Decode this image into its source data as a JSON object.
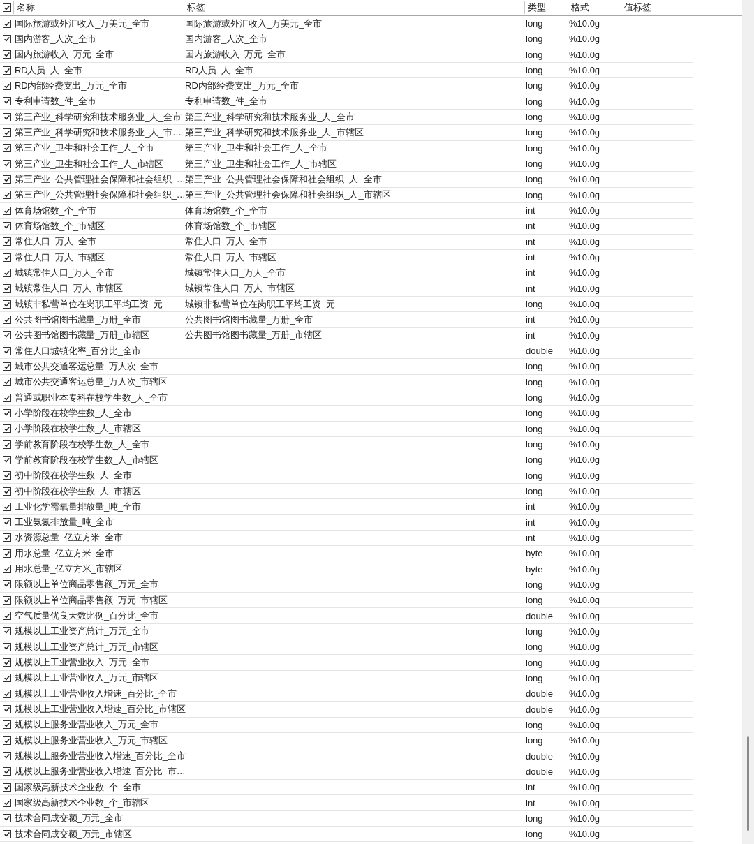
{
  "header": {
    "checked": true,
    "columns": [
      "名称",
      "标签",
      "类型",
      "格式",
      "值标签"
    ]
  },
  "rows": [
    {
      "checked": true,
      "name": "国际旅游或外汇收入_万美元_全市",
      "label": "国际旅游或外汇收入_万美元_全市",
      "type": "long",
      "format": "%10.0g"
    },
    {
      "checked": true,
      "name": "国内游客_人次_全市",
      "label": "国内游客_人次_全市",
      "type": "long",
      "format": "%10.0g"
    },
    {
      "checked": true,
      "name": "国内旅游收入_万元_全市",
      "label": "国内旅游收入_万元_全市",
      "type": "long",
      "format": "%10.0g"
    },
    {
      "checked": true,
      "name": "RD人员_人_全市",
      "label": "RD人员_人_全市",
      "type": "long",
      "format": "%10.0g"
    },
    {
      "checked": true,
      "name": "RD内部经费支出_万元_全市",
      "label": "RD内部经费支出_万元_全市",
      "type": "long",
      "format": "%10.0g"
    },
    {
      "checked": true,
      "name": "专利申请数_件_全市",
      "label": "专利申请数_件_全市",
      "type": "long",
      "format": "%10.0g"
    },
    {
      "checked": true,
      "name": "第三产业_科学研究和技术服务业_人_全市",
      "label": "第三产业_科学研究和技术服务业_人_全市",
      "type": "long",
      "format": "%10.0g"
    },
    {
      "checked": true,
      "name": "第三产业_科学研究和技术服务业_人_市…",
      "label": "第三产业_科学研究和技术服务业_人_市辖区",
      "type": "long",
      "format": "%10.0g"
    },
    {
      "checked": true,
      "name": "第三产业_卫生和社会工作_人_全市",
      "label": "第三产业_卫生和社会工作_人_全市",
      "type": "long",
      "format": "%10.0g"
    },
    {
      "checked": true,
      "name": "第三产业_卫生和社会工作_人_市辖区",
      "label": "第三产业_卫生和社会工作_人_市辖区",
      "type": "long",
      "format": "%10.0g"
    },
    {
      "checked": true,
      "name": "第三产业_公共管理社会保障和社会组织_…",
      "label": "第三产业_公共管理社会保障和社会组织_人_全市",
      "type": "long",
      "format": "%10.0g"
    },
    {
      "checked": true,
      "name": "第三产业_公共管理社会保障和社会组织_…",
      "label": "第三产业_公共管理社会保障和社会组织_人_市辖区",
      "type": "long",
      "format": "%10.0g"
    },
    {
      "checked": true,
      "name": "体育场馆数_个_全市",
      "label": "体育场馆数_个_全市",
      "type": "int",
      "format": "%10.0g"
    },
    {
      "checked": true,
      "name": "体育场馆数_个_市辖区",
      "label": "体育场馆数_个_市辖区",
      "type": "int",
      "format": "%10.0g"
    },
    {
      "checked": true,
      "name": "常住人口_万人_全市",
      "label": "常住人口_万人_全市",
      "type": "int",
      "format": "%10.0g"
    },
    {
      "checked": true,
      "name": "常住人口_万人_市辖区",
      "label": "常住人口_万人_市辖区",
      "type": "int",
      "format": "%10.0g"
    },
    {
      "checked": true,
      "name": "城镇常住人口_万人_全市",
      "label": "城镇常住人口_万人_全市",
      "type": "int",
      "format": "%10.0g"
    },
    {
      "checked": true,
      "name": "城镇常住人口_万人_市辖区",
      "label": "城镇常住人口_万人_市辖区",
      "type": "int",
      "format": "%10.0g"
    },
    {
      "checked": true,
      "name": "城镇非私营单位在岗职工平均工资_元",
      "label": "城镇非私营单位在岗职工平均工资_元",
      "type": "long",
      "format": "%10.0g"
    },
    {
      "checked": true,
      "name": "公共图书馆图书藏量_万册_全市",
      "label": "公共图书馆图书藏量_万册_全市",
      "type": "int",
      "format": "%10.0g"
    },
    {
      "checked": true,
      "name": "公共图书馆图书藏量_万册_市辖区",
      "label": "公共图书馆图书藏量_万册_市辖区",
      "type": "int",
      "format": "%10.0g"
    },
    {
      "checked": true,
      "name": "常住人口城镇化率_百分比_全市",
      "type": "double",
      "format": "%10.0g"
    },
    {
      "checked": true,
      "name": "城市公共交通客运总量_万人次_全市",
      "type": "long",
      "format": "%10.0g"
    },
    {
      "checked": true,
      "name": "城市公共交通客运总量_万人次_市辖区",
      "type": "long",
      "format": "%10.0g"
    },
    {
      "checked": true,
      "name": "普通或职业本专科在校学生数_人_全市",
      "type": "long",
      "format": "%10.0g"
    },
    {
      "checked": true,
      "name": "小学阶段在校学生数_人_全市",
      "type": "long",
      "format": "%10.0g"
    },
    {
      "checked": true,
      "name": "小学阶段在校学生数_人_市辖区",
      "type": "long",
      "format": "%10.0g"
    },
    {
      "checked": true,
      "name": "学前教育阶段在校学生数_人_全市",
      "type": "long",
      "format": "%10.0g"
    },
    {
      "checked": true,
      "name": "学前教育阶段在校学生数_人_市辖区",
      "type": "long",
      "format": "%10.0g"
    },
    {
      "checked": true,
      "name": "初中阶段在校学生数_人_全市",
      "type": "long",
      "format": "%10.0g"
    },
    {
      "checked": true,
      "name": "初中阶段在校学生数_人_市辖区",
      "type": "long",
      "format": "%10.0g"
    },
    {
      "checked": true,
      "name": "工业化学需氧量排放量_吨_全市",
      "type": "int",
      "format": "%10.0g"
    },
    {
      "checked": true,
      "name": "工业氨氮排放量_吨_全市",
      "type": "int",
      "format": "%10.0g"
    },
    {
      "checked": true,
      "name": "水资源总量_亿立方米_全市",
      "type": "int",
      "format": "%10.0g"
    },
    {
      "checked": true,
      "name": "用水总量_亿立方米_全市",
      "type": "byte",
      "format": "%10.0g"
    },
    {
      "checked": true,
      "name": "用水总量_亿立方米_市辖区",
      "type": "byte",
      "format": "%10.0g"
    },
    {
      "checked": true,
      "name": "限额以上单位商品零售额_万元_全市",
      "type": "long",
      "format": "%10.0g"
    },
    {
      "checked": true,
      "name": "限额以上单位商品零售额_万元_市辖区",
      "type": "long",
      "format": "%10.0g"
    },
    {
      "checked": true,
      "name": "空气质量优良天数比例_百分比_全市",
      "type": "double",
      "format": "%10.0g"
    },
    {
      "checked": true,
      "name": "规模以上工业资产总计_万元_全市",
      "type": "long",
      "format": "%10.0g"
    },
    {
      "checked": true,
      "name": "规模以上工业资产总计_万元_市辖区",
      "type": "long",
      "format": "%10.0g"
    },
    {
      "checked": true,
      "name": "规模以上工业营业收入_万元_全市",
      "type": "long",
      "format": "%10.0g"
    },
    {
      "checked": true,
      "name": "规模以上工业营业收入_万元_市辖区",
      "type": "long",
      "format": "%10.0g"
    },
    {
      "checked": true,
      "name": "规模以上工业营业收入增速_百分比_全市",
      "type": "double",
      "format": "%10.0g"
    },
    {
      "checked": true,
      "name": "规模以上工业营业收入增速_百分比_市辖区",
      "type": "double",
      "format": "%10.0g"
    },
    {
      "checked": true,
      "name": "规模以上服务业营业收入_万元_全市",
      "type": "long",
      "format": "%10.0g"
    },
    {
      "checked": true,
      "name": "规模以上服务业营业收入_万元_市辖区",
      "type": "long",
      "format": "%10.0g"
    },
    {
      "checked": true,
      "name": "规模以上服务业营业收入增速_百分比_全市",
      "type": "double",
      "format": "%10.0g"
    },
    {
      "checked": true,
      "name": "规模以上服务业营业收入增速_百分比_市…",
      "type": "double",
      "format": "%10.0g"
    },
    {
      "checked": true,
      "name": "国家级高新技术企业数_个_全市",
      "type": "int",
      "format": "%10.0g"
    },
    {
      "checked": true,
      "name": "国家级高新技术企业数_个_市辖区",
      "type": "int",
      "format": "%10.0g"
    },
    {
      "checked": true,
      "name": "技术合同成交额_万元_全市",
      "type": "long",
      "format": "%10.0g"
    },
    {
      "checked": true,
      "name": "技术合同成交额_万元_市辖区",
      "type": "long",
      "format": "%10.0g"
    }
  ]
}
